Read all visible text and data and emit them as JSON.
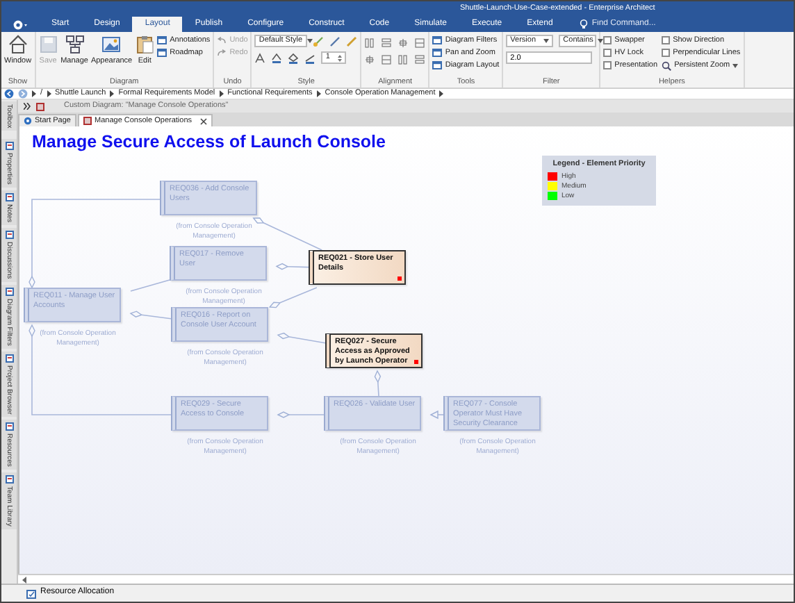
{
  "window": {
    "title": "Shuttle-Launch-Use-Case-extended - Enterprise Architect"
  },
  "ribbon_tabs": [
    {
      "label": "Start",
      "selected": false
    },
    {
      "label": "Design",
      "selected": false
    },
    {
      "label": "Layout",
      "selected": true
    },
    {
      "label": "Publish",
      "selected": false
    },
    {
      "label": "Configure",
      "selected": false
    },
    {
      "label": "Construct",
      "selected": false
    },
    {
      "label": "Code",
      "selected": false
    },
    {
      "label": "Simulate",
      "selected": false
    },
    {
      "label": "Execute",
      "selected": false
    },
    {
      "label": "Extend",
      "selected": false
    }
  ],
  "find_command": {
    "placeholder": "Find Command..."
  },
  "ribbon_groups": [
    {
      "kind": "buttons",
      "caption": "Show",
      "buttons": [
        {
          "label": "Window",
          "disabled": false
        }
      ]
    },
    {
      "kind": "buttons",
      "caption": "Diagram",
      "buttons": [
        {
          "label": "Save",
          "disabled": true
        },
        {
          "label": "Manage",
          "disabled": false
        },
        {
          "label": "Appearance",
          "disabled": false
        },
        {
          "label": "Edit",
          "disabled": false
        }
      ],
      "small_buttons": [
        {
          "label": "Annotations",
          "disabled": false
        },
        {
          "label": "Roadmap",
          "disabled": false
        }
      ]
    },
    {
      "kind": "buttons",
      "caption": "Undo",
      "small_buttons": [
        {
          "label": "Undo",
          "disabled": true
        },
        {
          "label": "Redo",
          "disabled": true
        }
      ]
    },
    {
      "kind": "style",
      "caption": "Style",
      "select": "Default Style",
      "spin": "1"
    },
    {
      "kind": "alignment",
      "caption": "Alignment"
    },
    {
      "kind": "buttons",
      "caption": "Tools",
      "small_buttons": [
        {
          "label": "Diagram Filters",
          "disabled": false
        },
        {
          "label": "Pan and Zoom",
          "disabled": false
        },
        {
          "label": "Diagram Layout",
          "disabled": false
        }
      ]
    },
    {
      "kind": "filter",
      "caption": "Filter",
      "selects": [
        "Version",
        "Contains"
      ],
      "value": "2.0"
    },
    {
      "kind": "helpers",
      "caption": "Helpers",
      "checkboxes": [
        {
          "label": "Swapper",
          "checked": false
        },
        {
          "label": "Show Direction",
          "checked": false
        },
        {
          "label": "HV Lock",
          "checked": false
        },
        {
          "label": "Perpendicular Lines",
          "checked": false
        },
        {
          "label": "Presentation",
          "checked": false
        }
      ],
      "zoom_button": "Persistent Zoom"
    }
  ],
  "breadcrumb": {
    "root": "/",
    "items": [
      "Shuttle Launch",
      "Formal Requirements Model",
      "Functional Requirements",
      "Console Operation Management"
    ]
  },
  "side_tabs": [
    "Toolbox",
    "Properties",
    "Notes",
    "Discussions",
    "Diagram Filters",
    "Project Browser",
    "Resources",
    "Team Library"
  ],
  "custom_diagram": "Custom Diagram: \"Manage Console Operations\"",
  "doc_tabs": [
    {
      "label": "Start Page",
      "selected": false,
      "closable": false
    },
    {
      "label": "Manage Console Operations",
      "selected": true,
      "closable": true
    }
  ],
  "diagram": {
    "title": "Manage Secure Access of Launch Console",
    "legend": {
      "title": "Legend - Element Priority",
      "items": [
        {
          "label": "High",
          "color": "#ff0000"
        },
        {
          "label": "Medium",
          "color": "#ffff00"
        },
        {
          "label": "Low",
          "color": "#00ff00"
        }
      ]
    },
    "nodes": [
      {
        "label": "REQ036 - Add Console Users",
        "highlighted": false,
        "note": "(from Console Operation Management)"
      },
      {
        "label": "REQ017 - Remove User",
        "highlighted": false,
        "note": "(from Console Operation Management)"
      },
      {
        "label": "REQ011 - Manage User Accounts",
        "highlighted": false,
        "note": "(from Console Operation Management)"
      },
      {
        "label": "REQ016 - Report on Console User Account",
        "highlighted": false,
        "note": "(from Console Operation Management)"
      },
      {
        "label": "REQ021 - Store User Details",
        "highlighted": true,
        "color": "#ff0000"
      },
      {
        "label": "REQ027 - Secure Access as Approved by Launch Operator",
        "highlighted": true,
        "color": "#ff0000"
      },
      {
        "label": "REQ029 - Secure Access to Console",
        "highlighted": false,
        "note": "(from Console Operation Management)"
      },
      {
        "label": "REQ026 - Validate User",
        "highlighted": false,
        "note": "(from Console Operation Management)"
      },
      {
        "label": "REQ077 - Console Operator Must Have Security Clearance",
        "highlighted": false,
        "note": "(from Console Operation Management)"
      }
    ]
  },
  "status_tabs": [
    "Resource Allocation"
  ]
}
